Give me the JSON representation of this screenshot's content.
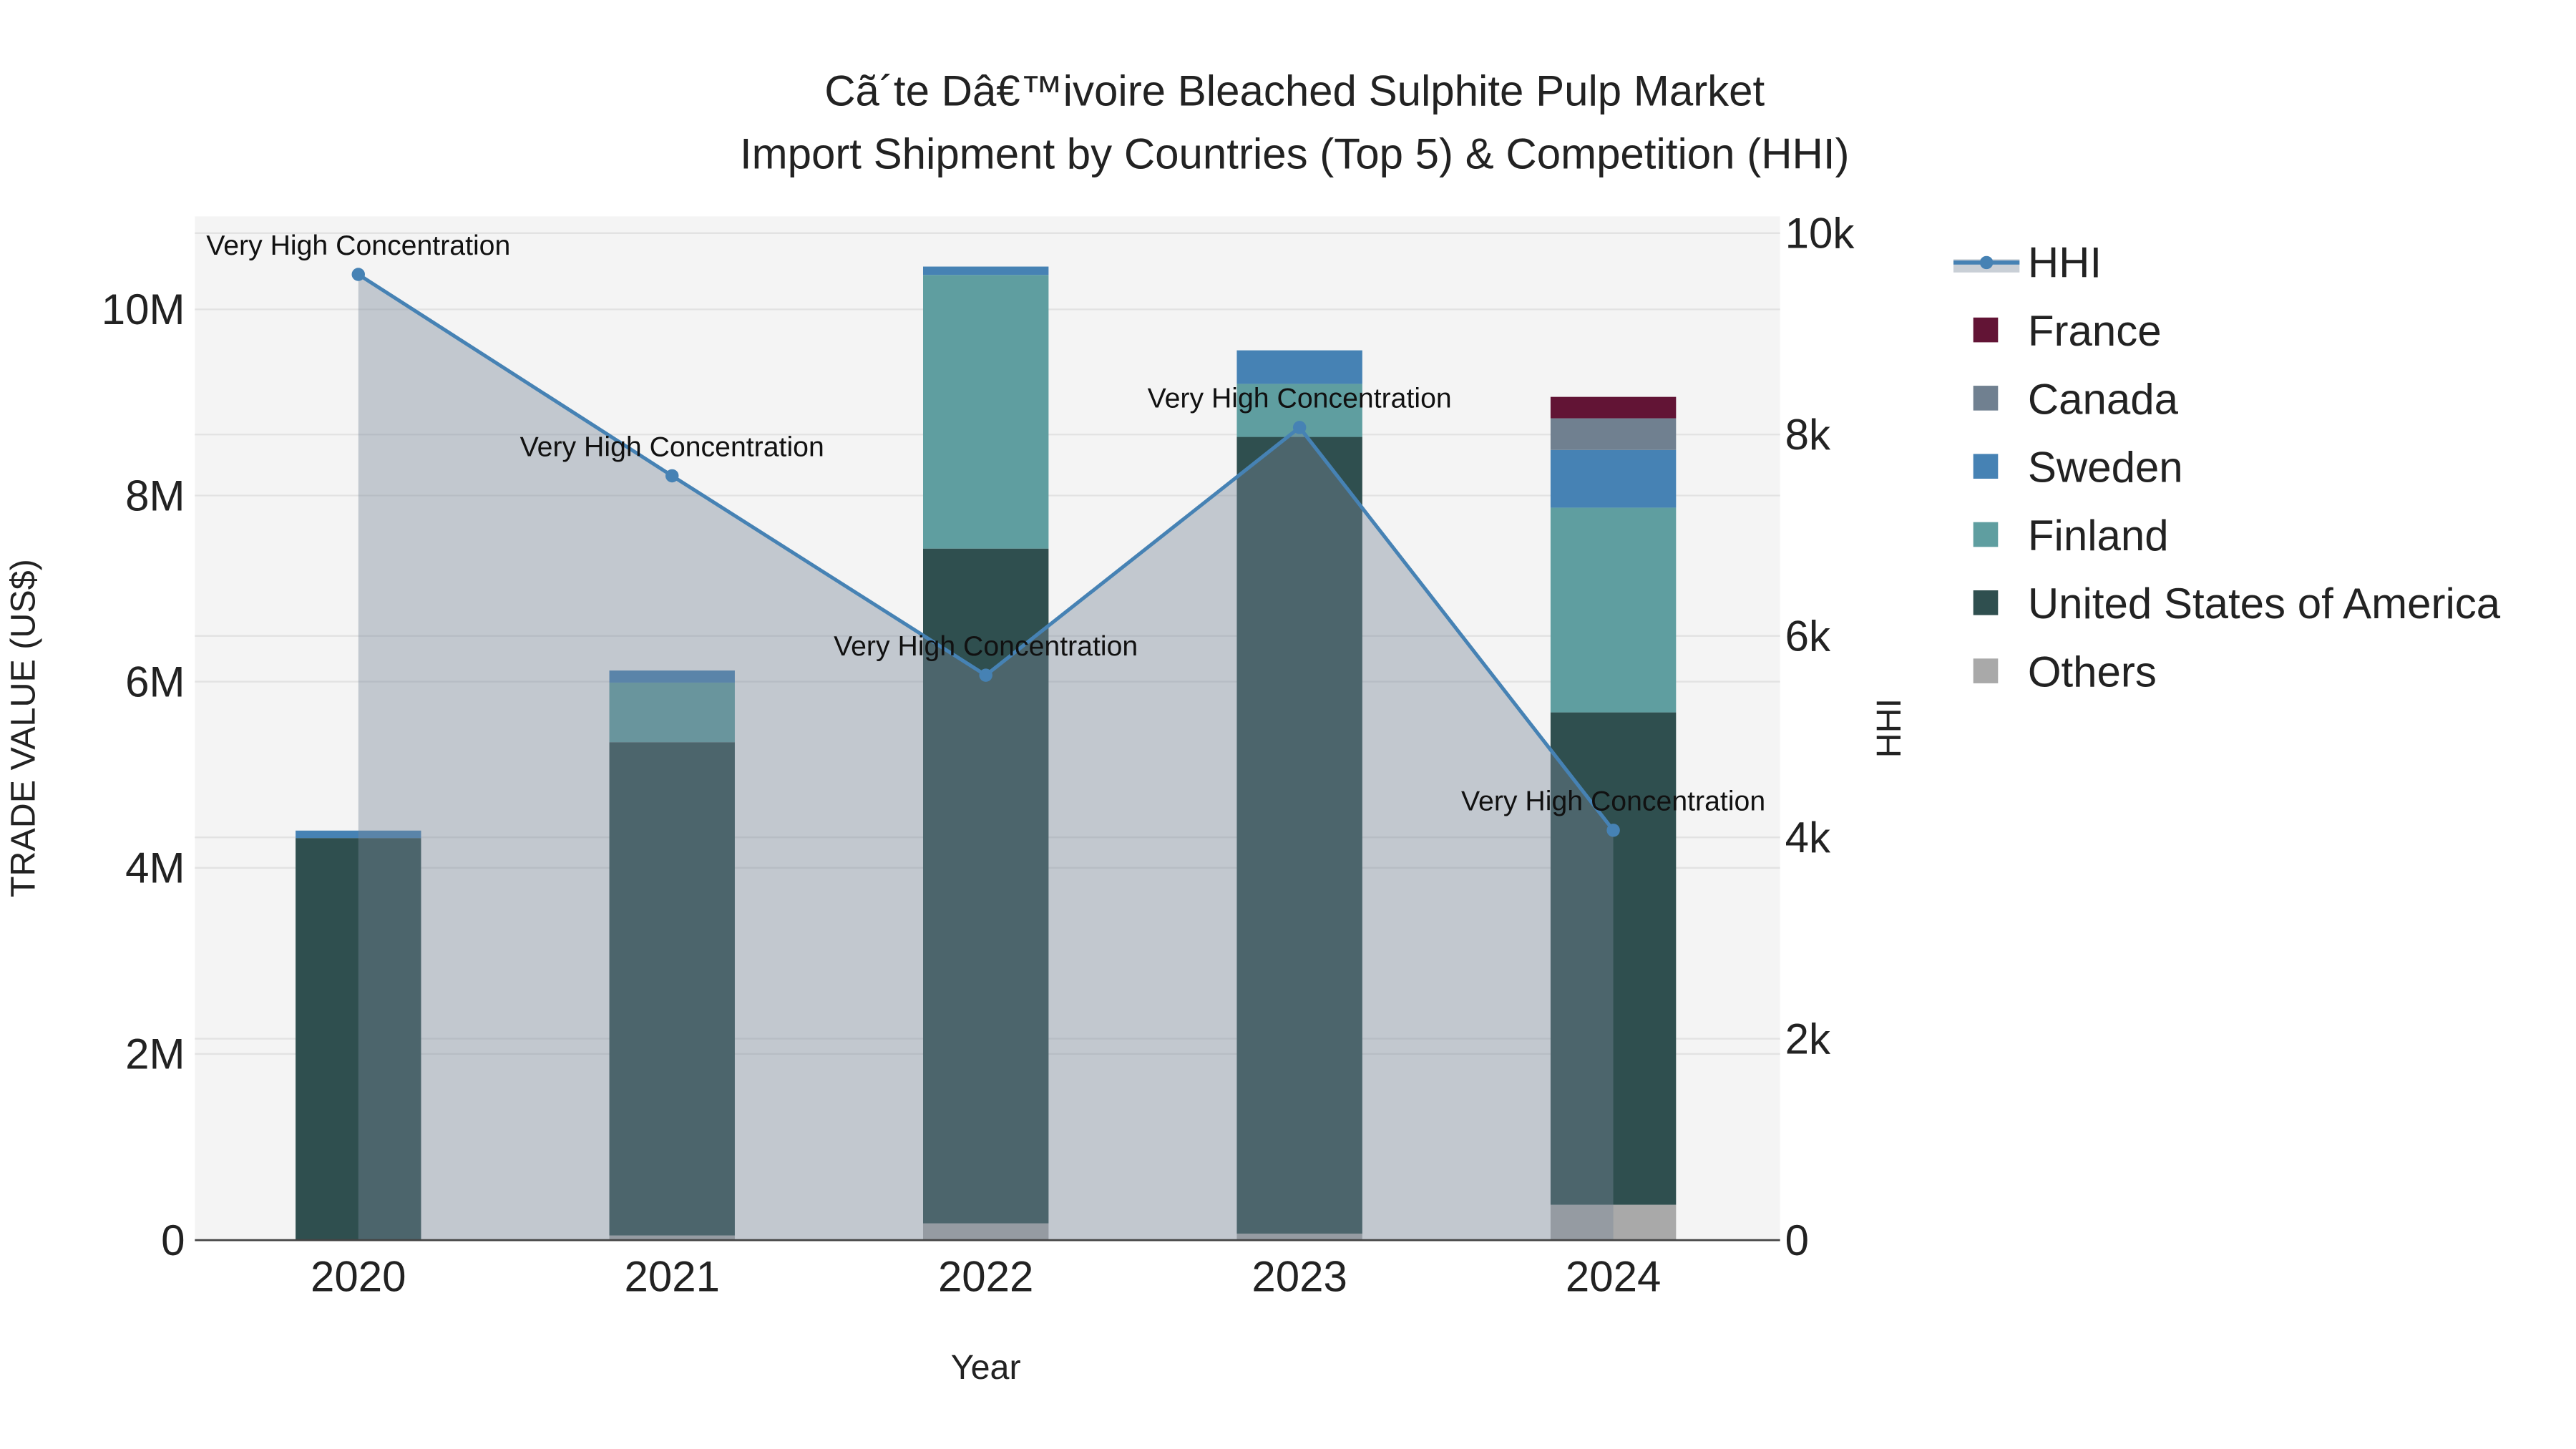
{
  "chart_data": {
    "type": "bar",
    "title": "Cã´te Dâ€™ivoire Bleached Sulphite Pulp Market",
    "subtitle": "Import Shipment by Countries (Top 5) & Competition (HHI)",
    "xlabel": "Year",
    "ylabel": "TRADE VALUE (US$)",
    "y2label": "HHI",
    "categories": [
      "2020",
      "2021",
      "2022",
      "2023",
      "2024"
    ],
    "ylim": [
      0,
      11000000
    ],
    "y2lim": [
      0,
      10167
    ],
    "yticks": [
      {
        "v": 0,
        "label": "0"
      },
      {
        "v": 2000000,
        "label": "2M"
      },
      {
        "v": 4000000,
        "label": "4M"
      },
      {
        "v": 6000000,
        "label": "6M"
      },
      {
        "v": 8000000,
        "label": "8M"
      },
      {
        "v": 10000000,
        "label": "10M"
      }
    ],
    "y2ticks": [
      {
        "v": 0,
        "label": "0"
      },
      {
        "v": 2000,
        "label": "2k"
      },
      {
        "v": 4000,
        "label": "4k"
      },
      {
        "v": 6000,
        "label": "6k"
      },
      {
        "v": 8000,
        "label": "8k"
      },
      {
        "v": 10000,
        "label": "10k"
      }
    ],
    "series": [
      {
        "name": "Others",
        "color": "#a9a9a9",
        "values": [
          0,
          50000,
          180000,
          70000,
          380000
        ]
      },
      {
        "name": "United States of America",
        "color": "#2f4f4f",
        "values": [
          4320000,
          5300000,
          7250000,
          8560000,
          5290000
        ]
      },
      {
        "name": "Finland",
        "color": "#5f9ea0",
        "values": [
          0,
          640000,
          2940000,
          570000,
          2200000
        ]
      },
      {
        "name": "Sweden",
        "color": "#4682b4",
        "values": [
          80000,
          130000,
          90000,
          360000,
          620000
        ]
      },
      {
        "name": "Canada",
        "color": "#708090",
        "values": [
          0,
          0,
          0,
          0,
          340000
        ]
      },
      {
        "name": "France",
        "color": "#621435",
        "values": [
          0,
          0,
          0,
          0,
          230000
        ]
      }
    ],
    "hhi": {
      "name": "HHI",
      "color": "#4682b4",
      "values": [
        9590,
        7590,
        5610,
        8070,
        4070
      ],
      "annotations": [
        "Very High Concentration",
        "Very High Concentration",
        "Very High Concentration",
        "Very High Concentration",
        "Very High Concentration"
      ]
    },
    "legend": [
      "HHI",
      "France",
      "Canada",
      "Sweden",
      "Finland",
      "United States of America",
      "Others"
    ],
    "legend_position": "right",
    "grid": true
  }
}
